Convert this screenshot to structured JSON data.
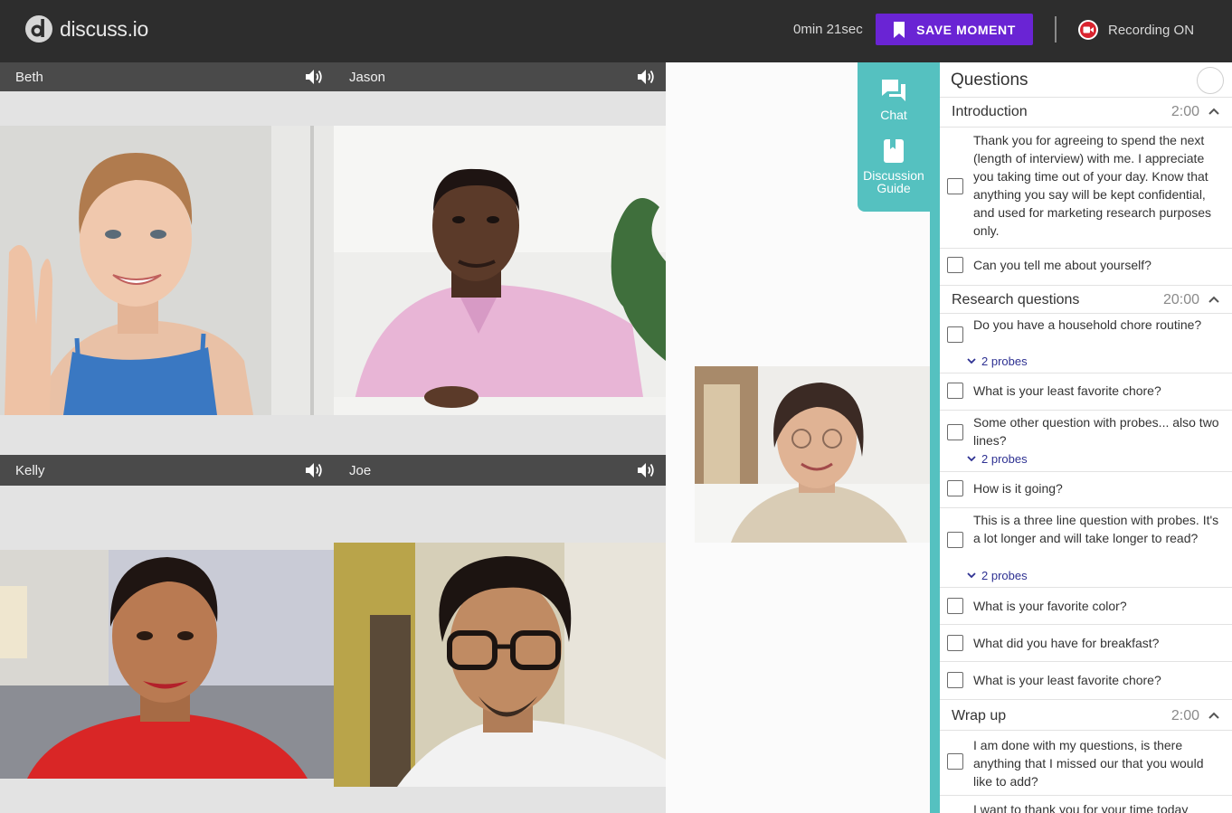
{
  "app": {
    "logo_text": "discuss.io"
  },
  "topbar": {
    "timer": "0min 21sec",
    "save_label": "SAVE MOMENT",
    "recording_label": "Recording ON"
  },
  "participants": [
    {
      "name": "Beth"
    },
    {
      "name": "Jason"
    },
    {
      "name": "Kelly"
    },
    {
      "name": "Joe"
    }
  ],
  "sidetabs": {
    "chat": "Chat",
    "guide_line1": "Discussion",
    "guide_line2": "Guide"
  },
  "panel": {
    "title": "Questions",
    "sections": [
      {
        "title": "Introduction",
        "duration": "2:00",
        "questions": [
          {
            "text": "Thank you for agreeing to spend the next (length of interview) with me.  I appreciate you taking time out of your day.  Know that anything you say will be kept confidential, and used for marketing research purposes only."
          },
          {
            "text": "Can you tell me about yourself?"
          }
        ]
      },
      {
        "title": "Research questions",
        "duration": "20:00",
        "questions": [
          {
            "text": "Do you have a household chore routine?",
            "probes": "2 probes"
          },
          {
            "text": "What is your least favorite chore?"
          },
          {
            "text": "Some other question with probes... also two lines?",
            "probes": "2 probes"
          },
          {
            "text": "How is it going?"
          },
          {
            "text": "This is a three line question with probes. It's a lot longer and will take longer to read?",
            "probes": "2 probes"
          },
          {
            "text": "What is your favorite color?"
          },
          {
            "text": "What did you have for breakfast?"
          },
          {
            "text": "What is your least favorite chore?"
          }
        ]
      },
      {
        "title": "Wrap up",
        "duration": "2:00",
        "questions": [
          {
            "text": "I am done with my questions, is there anything that I missed our that you would like to add?"
          },
          {
            "text": "I want to thank you for your time today"
          }
        ]
      }
    ]
  },
  "colors": {
    "topbar": "#2d2d2d",
    "accent_purple": "#6a24d4",
    "accent_teal": "#55c1c0",
    "record_red": "#d9242f",
    "probe_link": "#2e3192"
  }
}
